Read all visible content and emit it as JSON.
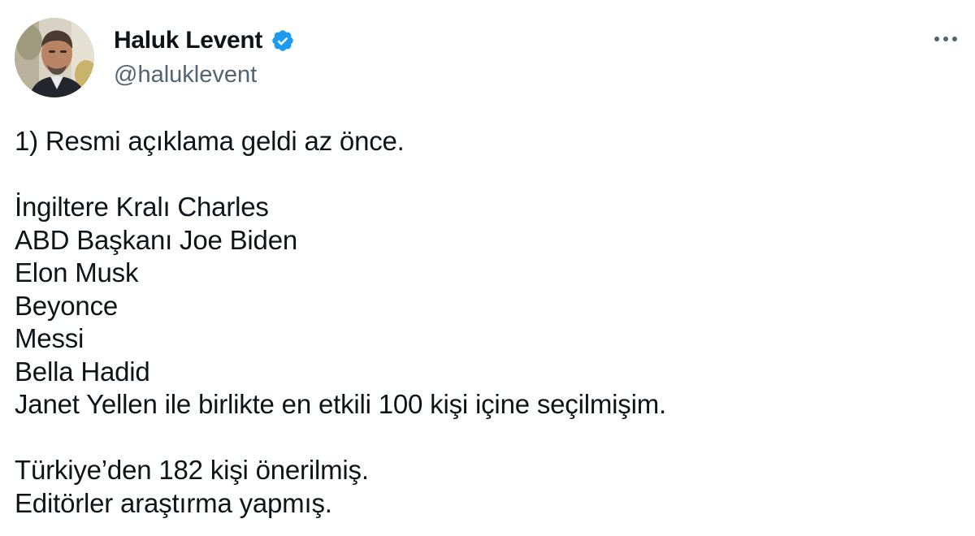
{
  "author": {
    "display_name": "Haluk Levent",
    "handle": "@haluklevent",
    "verified": true,
    "verified_color": "#1d9bf0"
  },
  "menu": {
    "icon": "more-horizontal-icon"
  },
  "tweet": {
    "lines": [
      "1) Resmi açıklama geldi az önce.",
      "",
      "İngiltere Kralı Charles",
      "ABD Başkanı Joe Biden",
      "Elon Musk",
      "Beyonce",
      "Messi",
      "Bella Hadid",
      "Janet Yellen ile birlikte en etkili 100 kişi içine seçilmişim.",
      "",
      "Türkiye’den 182 kişi önerilmiş.",
      "Editörler araştırma yapmış."
    ]
  },
  "colors": {
    "text": "#0f1419",
    "secondary_text": "#536471",
    "background": "#ffffff"
  }
}
